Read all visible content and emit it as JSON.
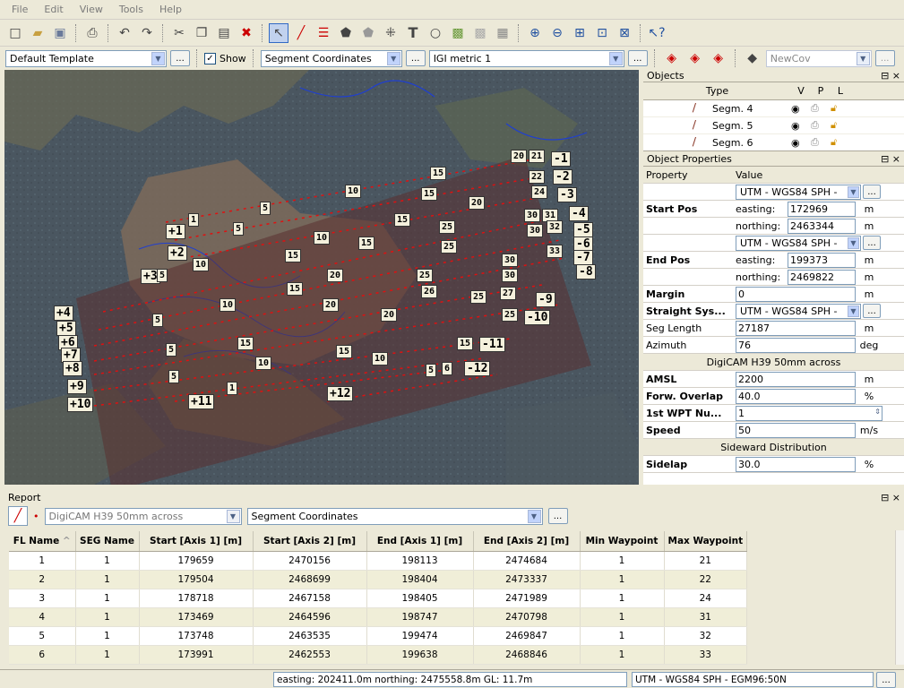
{
  "menu": [
    "File",
    "Edit",
    "View",
    "Tools",
    "Help"
  ],
  "toolbar2": {
    "template": "Default Template",
    "show_label": "Show",
    "coord_mode": "Segment Coordinates",
    "metric": "IGI metric 1",
    "coverage": "NewCov",
    "dots": "..."
  },
  "map": {
    "start_labels": [
      "+1",
      "+2",
      "+3",
      "+4",
      "+5",
      "+6",
      "+7",
      "+8",
      "+9",
      "+10",
      "+11",
      "+12"
    ],
    "end_labels": [
      "-1",
      "-2",
      "-3",
      "-4",
      "-5",
      "-6",
      "-7",
      "-8",
      "-9",
      "-10",
      "-11",
      "-12"
    ],
    "waypoint_labels": [
      "1",
      "5",
      "10",
      "15",
      "20",
      "21",
      "22",
      "24",
      "25",
      "26",
      "27",
      "30",
      "31",
      "32",
      "33",
      "6"
    ]
  },
  "objects": {
    "title": "Objects",
    "col_type": "Type",
    "col_v": "V",
    "col_p": "P",
    "col_l": "L",
    "items": [
      "Segm. 4",
      "Segm. 5",
      "Segm. 6"
    ]
  },
  "props": {
    "title": "Object Properties",
    "col_property": "Property",
    "col_value": "Value",
    "start_pos": "Start Pos",
    "end_pos": "End Pos",
    "crs": "UTM - WGS84 SPH -",
    "easting_label": "easting:",
    "northing_label": "northing:",
    "start_easting": "172969",
    "start_northing": "2463344",
    "end_easting": "199373",
    "end_northing": "2469822",
    "unit_m": "m",
    "margin_label": "Margin",
    "margin_value": "0",
    "straight_label": "Straight Sys...",
    "seglen_label": "Seg Length",
    "seglen_value": "27187",
    "azimuth_label": "Azimuth",
    "azimuth_value": "76",
    "unit_deg": "deg",
    "camera_header": "DigiCAM H39 50mm across",
    "amsl_label": "AMSL",
    "amsl_value": "2200",
    "forw_label": "Forw. Overlap",
    "forw_value": "40.0",
    "unit_pct": "%",
    "wpt_label": "1st WPT Nu...",
    "wpt_value": "1",
    "speed_label": "Speed",
    "speed_value": "50",
    "unit_ms": "m/s",
    "side_header": "Sideward Distribution",
    "sidelap_label": "Sidelap",
    "sidelap_value": "30.0"
  },
  "report": {
    "title": "Report",
    "camera": "DigiCAM H39 50mm across",
    "coord_mode": "Segment Coordinates",
    "columns": [
      "FL Name",
      "SEG Name",
      "Start [Axis 1] [m]",
      "Start [Axis 2] [m]",
      "End [Axis 1] [m]",
      "End [Axis 2] [m]",
      "Min Waypoint",
      "Max Waypoint"
    ],
    "rows": [
      [
        "1",
        "1",
        "179659",
        "2470156",
        "198113",
        "2474684",
        "1",
        "21"
      ],
      [
        "2",
        "1",
        "179504",
        "2468699",
        "198404",
        "2473337",
        "1",
        "22"
      ],
      [
        "3",
        "1",
        "178718",
        "2467158",
        "198405",
        "2471989",
        "1",
        "24"
      ],
      [
        "4",
        "1",
        "173469",
        "2464596",
        "198747",
        "2470798",
        "1",
        "31"
      ],
      [
        "5",
        "1",
        "173748",
        "2463535",
        "199474",
        "2469847",
        "1",
        "32"
      ],
      [
        "6",
        "1",
        "173991",
        "2462553",
        "199638",
        "2468846",
        "1",
        "33"
      ]
    ]
  },
  "status": {
    "coords": "easting: 202411.0m northing: 2475558.8m GL: 11.7m",
    "crs": "UTM - WGS84 SPH - EGM96:50N"
  }
}
